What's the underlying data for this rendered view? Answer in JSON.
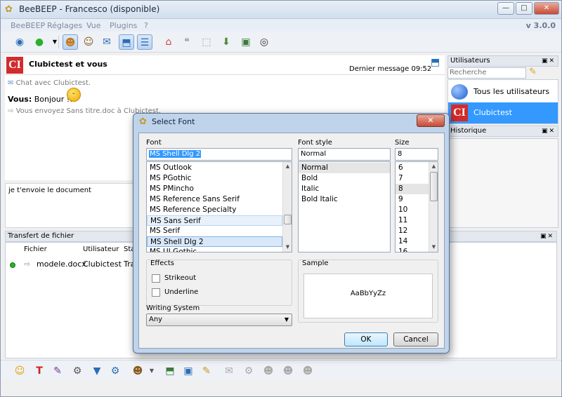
{
  "window": {
    "title": "BeeBEEP - Francesco (disponible)",
    "controls": {
      "minimize": "—",
      "maximize": "□",
      "close": "✕"
    }
  },
  "menubar": {
    "items": [
      "BeeBEEP",
      "Réglages",
      "Vue",
      "Plugins",
      "?"
    ],
    "version": "v 3.0.0"
  },
  "chat": {
    "logo": "CI",
    "title": "Clubictest et vous",
    "last_message": "Dernier message 09:52",
    "lines": {
      "header": "Chat avec Clubictest.",
      "message_author": "Vous:",
      "message_text": " Bonjour !!!",
      "file_notice": "Vous envoyez Sans titre.doc à Clubictest."
    },
    "input_text": "je t'envoie le document"
  },
  "users_panel": {
    "title": "Utilisateurs",
    "search_placeholder": "Recherche",
    "items": [
      {
        "label": "Tous les utilisateurs"
      },
      {
        "label": "Clubictest",
        "logo": "CI"
      }
    ]
  },
  "history_panel": {
    "title": "Historique"
  },
  "transfer_panel": {
    "title": "Transfert de fichier",
    "columns": [
      "Fichier",
      "Utilisateur",
      "Sta"
    ],
    "row": {
      "file": "modele.docx",
      "user": "Clubictest",
      "status": "Tra"
    }
  },
  "dialog": {
    "title": "Select Font",
    "font": {
      "label": "Font",
      "value": "MS Shell Dlg 2",
      "options": [
        "MS Outlook",
        "MS PGothic",
        "MS PMincho",
        "MS Reference Sans Serif",
        "MS Reference Specialty",
        "MS Sans Serif",
        "MS Serif",
        "MS Shell Dlg 2",
        "MS UI Gothic"
      ]
    },
    "style": {
      "label": "Font style",
      "value": "Normal",
      "options": [
        "Normal",
        "Bold",
        "Italic",
        "Bold Italic"
      ]
    },
    "size": {
      "label": "Size",
      "value": "8",
      "options": [
        "6",
        "7",
        "8",
        "9",
        "10",
        "11",
        "12",
        "14",
        "16"
      ]
    },
    "effects": {
      "label": "Effects",
      "strikeout": "Strikeout",
      "underline": "Underline"
    },
    "writing_system": {
      "label": "Writing System",
      "value": "Any"
    },
    "sample": {
      "label": "Sample",
      "text": "AaBbYyZz"
    },
    "buttons": {
      "ok": "OK",
      "cancel": "Cancel"
    }
  }
}
